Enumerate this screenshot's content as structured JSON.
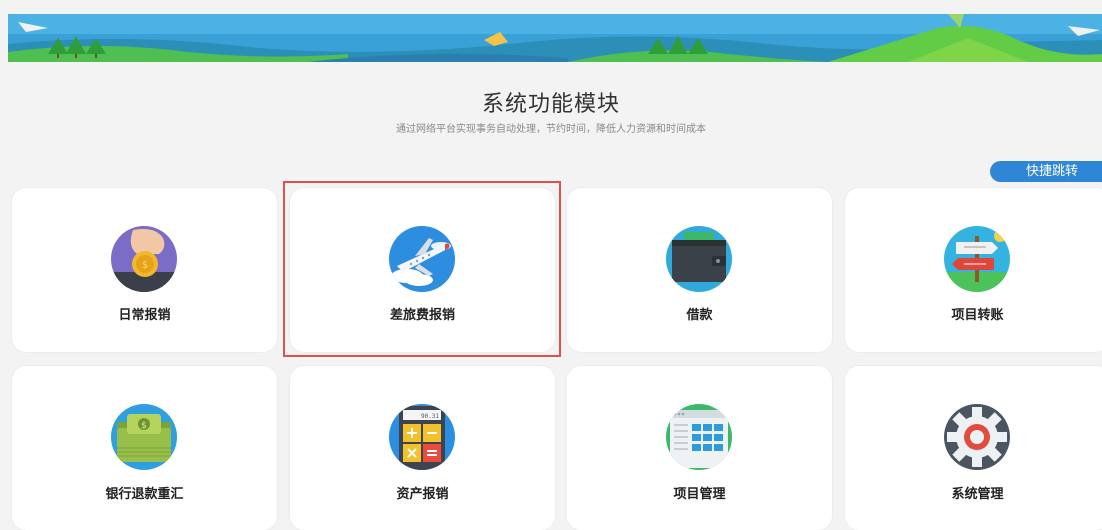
{
  "header": {
    "title": "系统功能模块",
    "subtitle": "通过网络平台实现事务自动处理，节约时间，降低人力资源和时间成本",
    "quick_jump": "快捷跳转"
  },
  "modules": [
    {
      "label": "日常报销",
      "icon": "coin-hand-icon"
    },
    {
      "label": "差旅费报销",
      "icon": "airplane-icon"
    },
    {
      "label": "借款",
      "icon": "wallet-icon"
    },
    {
      "label": "项目转账",
      "icon": "signpost-icon"
    },
    {
      "label": "银行退款重汇",
      "icon": "money-stack-icon"
    },
    {
      "label": "资产报销",
      "icon": "calculator-icon"
    },
    {
      "label": "项目管理",
      "icon": "grid-table-icon"
    },
    {
      "label": "系统管理",
      "icon": "gear-icon"
    }
  ],
  "calculator_display": "90.31",
  "selected_module": "差旅费报销",
  "colors": {
    "accent": "#2f86d6",
    "highlight_border": "#e0504c",
    "banner_sky": "#3aa0d8",
    "banner_grass": "#5cc84a"
  }
}
